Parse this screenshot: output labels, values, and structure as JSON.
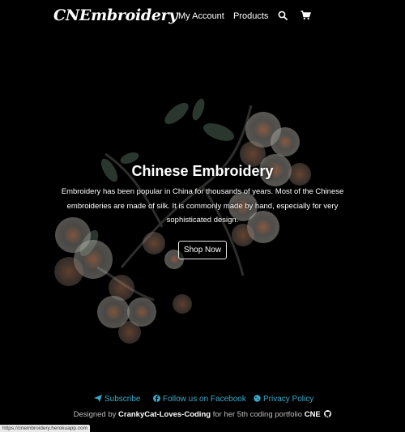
{
  "brand": {
    "name": "CNEmbroidery"
  },
  "nav": {
    "account": "My Account",
    "products": "Products",
    "search_icon": "search-icon",
    "cart_icon": "cart-icon"
  },
  "hero": {
    "title": "Chinese Embroidery",
    "text": "Embroidery has been popular in China for thousands of years. Most of the Chinese embroideries are made of silk. It is commonly made by hand, especially for very sophisticated design.",
    "button": "Shop Now"
  },
  "footer": {
    "subscribe": "Subscribe",
    "facebook": "Follow us on Facebook",
    "privacy": "Privacy Policy",
    "credit_prefix": "Designed by",
    "credit_author": "CrankyCat-Loves-Coding",
    "credit_middle": "for her 5th coding portfolio",
    "credit_suffix": "CNE",
    "link_color": "#3aa9c9"
  },
  "status_bar": {
    "url": "https://cnembroidery.herokuapp.com"
  },
  "colors": {
    "background": "#000000",
    "text": "#ffffff",
    "petal": "#c9c7c2",
    "petal_blush": "#c77a5a",
    "leaf": "#5e7a66"
  }
}
